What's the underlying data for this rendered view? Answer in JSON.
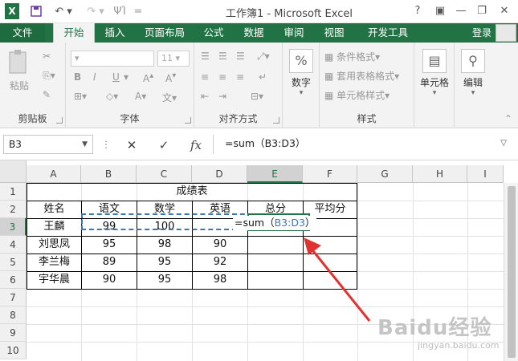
{
  "app": {
    "title": "工作簿1 - Microsoft Excel",
    "excel_icon": "excel-icon"
  },
  "window_controls": {
    "help": "?",
    "restore": "▣",
    "minimize": "—",
    "restore2": "❐",
    "close": "✕"
  },
  "tabs": [
    "文件",
    "开始",
    "插入",
    "页面布局",
    "公式",
    "数据",
    "审阅",
    "视图",
    "开发工具"
  ],
  "active_tab": "开始",
  "login": "登录",
  "ribbon": {
    "clipboard": {
      "label": "剪贴板",
      "paste": "粘贴"
    },
    "font": {
      "label": "字体",
      "size": "11",
      "bold": "B",
      "italic": "I",
      "underline": "U"
    },
    "alignment": {
      "label": "对齐方式"
    },
    "number": {
      "label": "数字",
      "percent": "%"
    },
    "styles": {
      "label": "样式",
      "items": [
        "条件格式",
        "套用表格格式",
        "单元格样式"
      ]
    },
    "cells": {
      "label": "单元格"
    },
    "editing": {
      "label": "编辑"
    }
  },
  "formula_bar": {
    "name_box": "B3",
    "cancel": "✕",
    "confirm": "✓",
    "fx": "fx",
    "formula": "=sum（B3:D3）"
  },
  "columns": [
    "A",
    "B",
    "C",
    "D",
    "E",
    "F",
    "G",
    "H",
    "I"
  ],
  "selected_column": "E",
  "rows": [
    "1",
    "2",
    "3",
    "4",
    "5",
    "6",
    "7",
    "8",
    "9",
    "10"
  ],
  "selected_row": "3",
  "sheet": {
    "title": "成绩表",
    "headers": [
      "姓名",
      "语文",
      "数学",
      "英语",
      "总分",
      "平均分"
    ],
    "records": [
      {
        "name": "王麟",
        "chinese": "99",
        "math": "100",
        "english": ""
      },
      {
        "name": "刘思凤",
        "chinese": "95",
        "math": "98",
        "english": "90"
      },
      {
        "name": "李兰梅",
        "chinese": "89",
        "math": "95",
        "english": "92"
      },
      {
        "name": "宇华晨",
        "chinese": "90",
        "math": "95",
        "english": "98"
      }
    ],
    "editing_text": {
      "prefix": "=sum（",
      "ref": "B3:D3",
      "suffix": "）"
    }
  },
  "watermark": {
    "brand": "Baidu经验",
    "url": "jingyan.baidu.com"
  },
  "colors": {
    "excel_green": "#217346",
    "ref_blue": "#3a78b5",
    "arrow_red": "#e0322f"
  }
}
